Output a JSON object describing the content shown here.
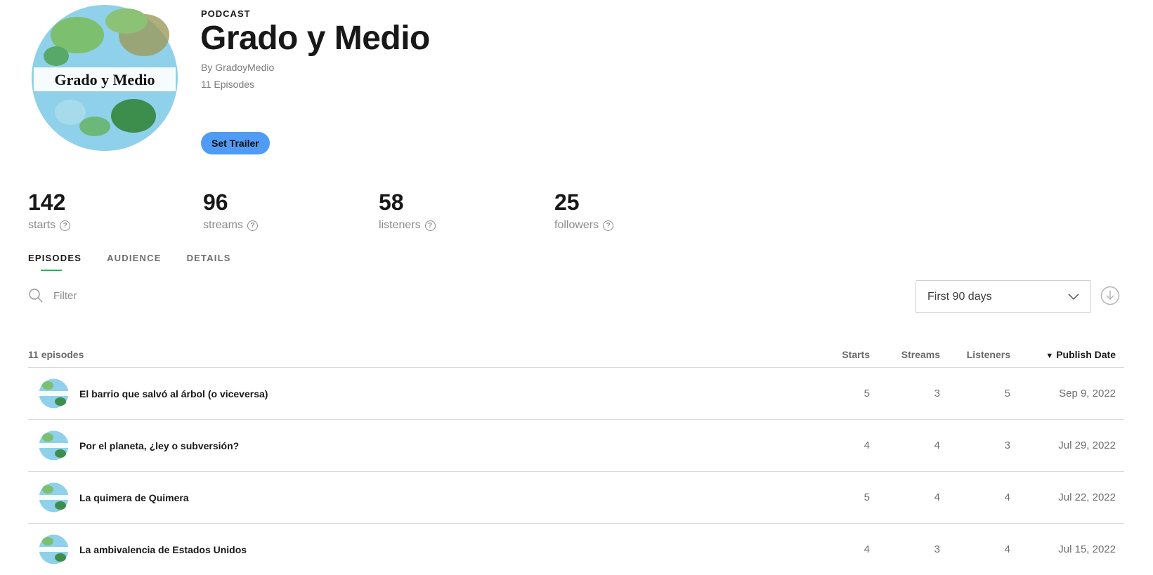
{
  "podcast": {
    "cover_text": "Grado y Medio",
    "type_label": "PODCAST",
    "title": "Grado y Medio",
    "author": "By GradoyMedio",
    "episode_count": "11 Episodes",
    "trailer_button": "Set Trailer"
  },
  "stats": [
    {
      "value": "142",
      "label": "starts"
    },
    {
      "value": "96",
      "label": "streams"
    },
    {
      "value": "58",
      "label": "listeners"
    },
    {
      "value": "25",
      "label": "followers"
    }
  ],
  "tabs": [
    {
      "label": "EPISODES",
      "active": true
    },
    {
      "label": "AUDIENCE",
      "active": false
    },
    {
      "label": "DETAILS",
      "active": false
    }
  ],
  "filter": {
    "placeholder": "Filter"
  },
  "range_select": {
    "value": "First 90 days"
  },
  "table": {
    "count_label": "11 episodes",
    "columns": [
      "Starts",
      "Streams",
      "Listeners",
      "Publish Date"
    ],
    "sort_indicator": "▼",
    "rows": [
      {
        "title": "El barrio que salvó al árbol (o viceversa)",
        "starts": "5",
        "streams": "3",
        "listeners": "5",
        "date": "Sep 9, 2022"
      },
      {
        "title": "Por el planeta, ¿ley o subversión?",
        "starts": "4",
        "streams": "4",
        "listeners": "3",
        "date": "Jul 29, 2022"
      },
      {
        "title": "La quimera de Quimera",
        "starts": "5",
        "streams": "4",
        "listeners": "4",
        "date": "Jul 22, 2022"
      },
      {
        "title": "La ambivalencia de Estados Unidos",
        "starts": "4",
        "streams": "3",
        "listeners": "4",
        "date": "Jul 15, 2022"
      }
    ]
  },
  "colors": {
    "accent": "#1db954",
    "button": "#509bf5",
    "text": "#181818",
    "muted": "#8a8a8a"
  }
}
